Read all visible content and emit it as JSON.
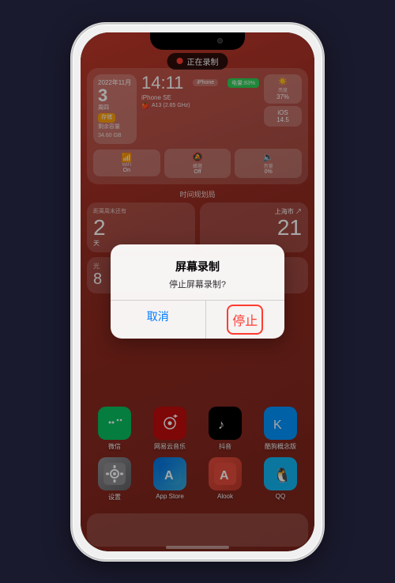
{
  "phone": {
    "recording_banner": "正在录制",
    "notch_visible": true
  },
  "widget": {
    "date_label": "2022年11月",
    "day": "3",
    "weekday": "周四",
    "storage_badge": "存储",
    "capacity": "剩余容量",
    "capacity_value": "34.60 GB",
    "time": "14:11",
    "iphone_label": "iPhone",
    "battery": "电量:83%",
    "model": "iPhone SE",
    "cpu": "A13 (2.65 GHz)",
    "brightness_label": "亮度",
    "brightness_value": "37%",
    "phone_icon": "📱",
    "ios_label": "iOS",
    "ios_value": "14.5",
    "wifi_label": "WiFi",
    "wifi_value": "On",
    "mute_label": "蜂窝",
    "mute_value": "Off",
    "sound_label": "音量",
    "sound_value": "0%",
    "section_title": "时间规划局",
    "week_title": "距离周末还有",
    "week_num": "2",
    "week_unit": "天",
    "sun_title": "上海市",
    "sun_temp": "21",
    "partial_label": "光",
    "partial_value": "8"
  },
  "dialog": {
    "title": "屏幕录制",
    "message": "停止屏幕录制?",
    "cancel_label": "取消",
    "stop_label": "停止"
  },
  "apps_row1": [
    {
      "name": "微信",
      "icon_class": "icon-wechat",
      "icon": "💬"
    },
    {
      "name": "网易云音乐",
      "icon_class": "icon-netease",
      "icon": "🎵"
    },
    {
      "name": "抖音",
      "icon_class": "icon-tiktok",
      "icon": "♪"
    },
    {
      "name": "酷狗概念版",
      "icon_class": "icon-kugou",
      "icon": "🎧"
    }
  ],
  "apps_row2": [
    {
      "name": "设置",
      "icon_class": "icon-settings",
      "icon": "⚙️"
    },
    {
      "name": "App Store",
      "icon_class": "icon-appstore",
      "icon": "A"
    },
    {
      "name": "Alook",
      "icon_class": "icon-alook",
      "icon": "A"
    },
    {
      "name": "QQ",
      "icon_class": "icon-qq",
      "icon": "🐧"
    }
  ]
}
